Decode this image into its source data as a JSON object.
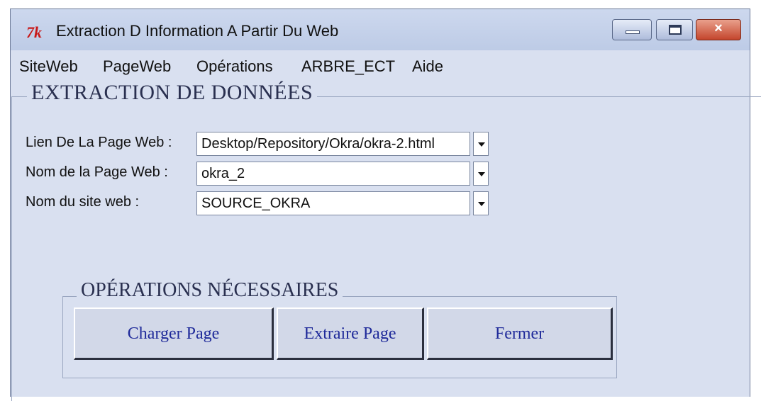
{
  "window": {
    "icon_text": "7k",
    "title": "Extraction D Information A Partir Du Web",
    "controls": {
      "minimize": "minimize",
      "maximize": "maximize",
      "close": "×"
    }
  },
  "menu": {
    "items": [
      "SiteWeb",
      "PageWeb",
      "Opérations",
      "ARBRE_ECT",
      "Aide"
    ]
  },
  "extraction": {
    "title": "EXTRACTION DE DONNÉES",
    "fields": [
      {
        "label": "Lien De La Page Web :",
        "value": "Desktop/Repository/Okra/okra-2.html"
      },
      {
        "label": "Nom de la Page Web :",
        "value": "okra_2"
      },
      {
        "label": "Nom du site web :",
        "value": "SOURCE_OKRA"
      }
    ]
  },
  "operations": {
    "title": "OPÉRATIONS NÉCESSAIRES",
    "buttons": [
      "Charger Page",
      "Extraire Page",
      "Fermer"
    ]
  },
  "colors": {
    "window_bg": "#d9e0f0",
    "button_text": "#1f2a9a",
    "close_button": "#c4452c"
  }
}
